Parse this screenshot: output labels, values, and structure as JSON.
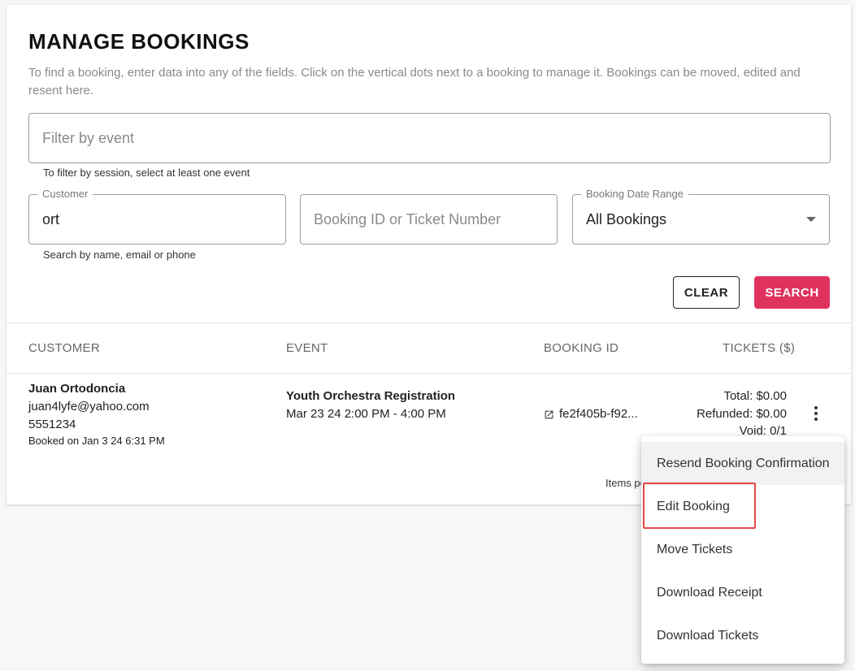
{
  "page": {
    "title": "MANAGE BOOKINGS",
    "description": "To find a booking, enter data into any of the fields. Click on the vertical dots next to a booking to manage it. Bookings can be moved, edited and resent here."
  },
  "filters": {
    "event": {
      "placeholder": "Filter by event",
      "helper": "To filter by session, select at least one event"
    },
    "customer": {
      "label": "Customer",
      "value": "ort",
      "helper": "Search by name, email or phone"
    },
    "booking_id": {
      "placeholder": "Booking ID or Ticket Number"
    },
    "date_range": {
      "label": "Booking Date Range",
      "value": "All Bookings"
    }
  },
  "buttons": {
    "clear": "CLEAR",
    "search": "SEARCH"
  },
  "table": {
    "headers": {
      "customer": "CUSTOMER",
      "event": "EVENT",
      "booking_id": "BOOKING ID",
      "tickets": "TICKETS ($)"
    },
    "rows": [
      {
        "customer_name": "Juan Ortodoncia",
        "email": "juan4lyfe@yahoo.com",
        "phone": "5551234",
        "booked_on": "Booked on Jan 3 24 6:31 PM",
        "event_name": "Youth Orchestra Registration",
        "event_time": "Mar 23 24 2:00 PM - 4:00 PM",
        "booking_id": "fe2f405b-f92...",
        "total": "Total: $0.00",
        "refunded": "Refunded: $0.00",
        "void": "Void: 0/1"
      }
    ]
  },
  "pagination": {
    "items_per_page_label": "Items pe"
  },
  "context_menu": {
    "items": [
      "Resend Booking Confirmation",
      "Edit Booking",
      "Move Tickets",
      "Download Receipt",
      "Download Tickets"
    ]
  },
  "colors": {
    "accent": "#e0325f",
    "highlight": "#e44747"
  },
  "icons": {
    "link": "open-in-new-icon",
    "menu": "more-vert-icon",
    "dropdown": "caret-down-icon"
  }
}
